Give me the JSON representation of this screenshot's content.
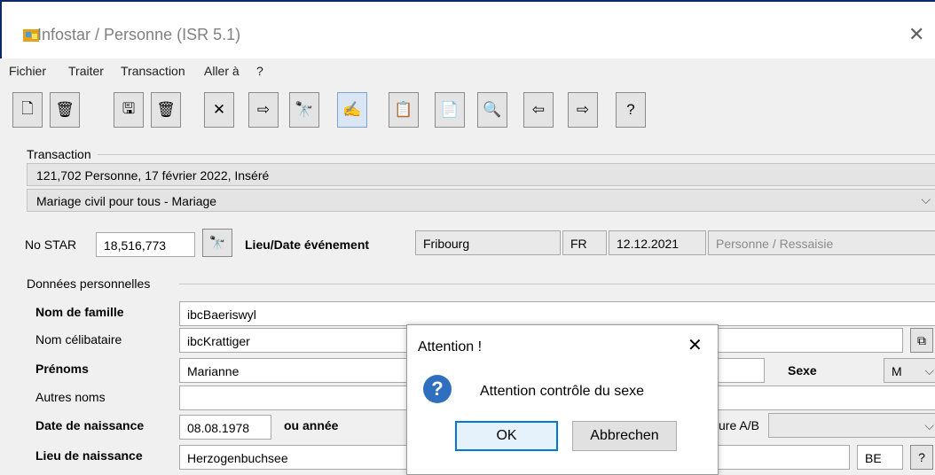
{
  "window": {
    "title": "Infostar / Personne (ISR 5.1)"
  },
  "menu": [
    "Fichier",
    "Traiter",
    "Transaction",
    "Aller à",
    "?"
  ],
  "toolbar": [
    {
      "name": "new-doc-icon",
      "glyph": "🗋"
    },
    {
      "name": "trash-can-icon",
      "glyph": "🗑"
    },
    {
      "name": "save-icon",
      "glyph": "🖫"
    },
    {
      "name": "trash-bin-icon",
      "glyph": "🗑"
    },
    {
      "name": "cancel-icon",
      "glyph": "✕"
    },
    {
      "name": "import-icon",
      "glyph": "⇨"
    },
    {
      "name": "binoculars-icon",
      "glyph": "🔭"
    },
    {
      "name": "sign-pen-icon",
      "glyph": "✍"
    },
    {
      "name": "clipboard-icon",
      "glyph": "📋"
    },
    {
      "name": "document-icon",
      "glyph": "📄"
    },
    {
      "name": "preview-icon",
      "glyph": "🔍"
    },
    {
      "name": "arrow-left-icon",
      "glyph": "⇦"
    },
    {
      "name": "arrow-right-icon",
      "glyph": "⇨"
    },
    {
      "name": "help-icon",
      "glyph": "?"
    }
  ],
  "transaction": {
    "label": "Transaction",
    "row1": "121,702  Personne, 17 février 2022, Inséré",
    "row2": "Mariage civil pour tous - Mariage"
  },
  "star": {
    "label": "No STAR",
    "value": "18,516,773",
    "event_label": "Lieu/Date événement",
    "place": "Fribourg",
    "canton": "FR",
    "date": "12.12.2021",
    "status": "Personne / Ressaisie"
  },
  "personal": {
    "label": "Données personnelles",
    "family_name_label": "Nom de famille",
    "family_name": "ibcBaeriswyl",
    "maiden_label": "Nom célibataire",
    "maiden": "ibcKrattiger",
    "firstnames_label": "Prénoms",
    "firstnames": "Marianne",
    "sex_label": "Sexe",
    "sex": "M",
    "other_names_label": "Autres noms",
    "birthdate_label": "Date de naissance",
    "birthdate": "08.08.1978",
    "year_label": "ou année",
    "nature_label": "ure A/B",
    "birthplace_label": "Lieu de naissance",
    "birthplace": "Herzogenbuchsee",
    "birthplace_canton": "BE",
    "help": "?"
  },
  "dialog": {
    "title": "Attention !",
    "message": "Attention contrôle du sexe",
    "ok": "OK",
    "cancel": "Abbrechen",
    "icon": "question-icon"
  }
}
